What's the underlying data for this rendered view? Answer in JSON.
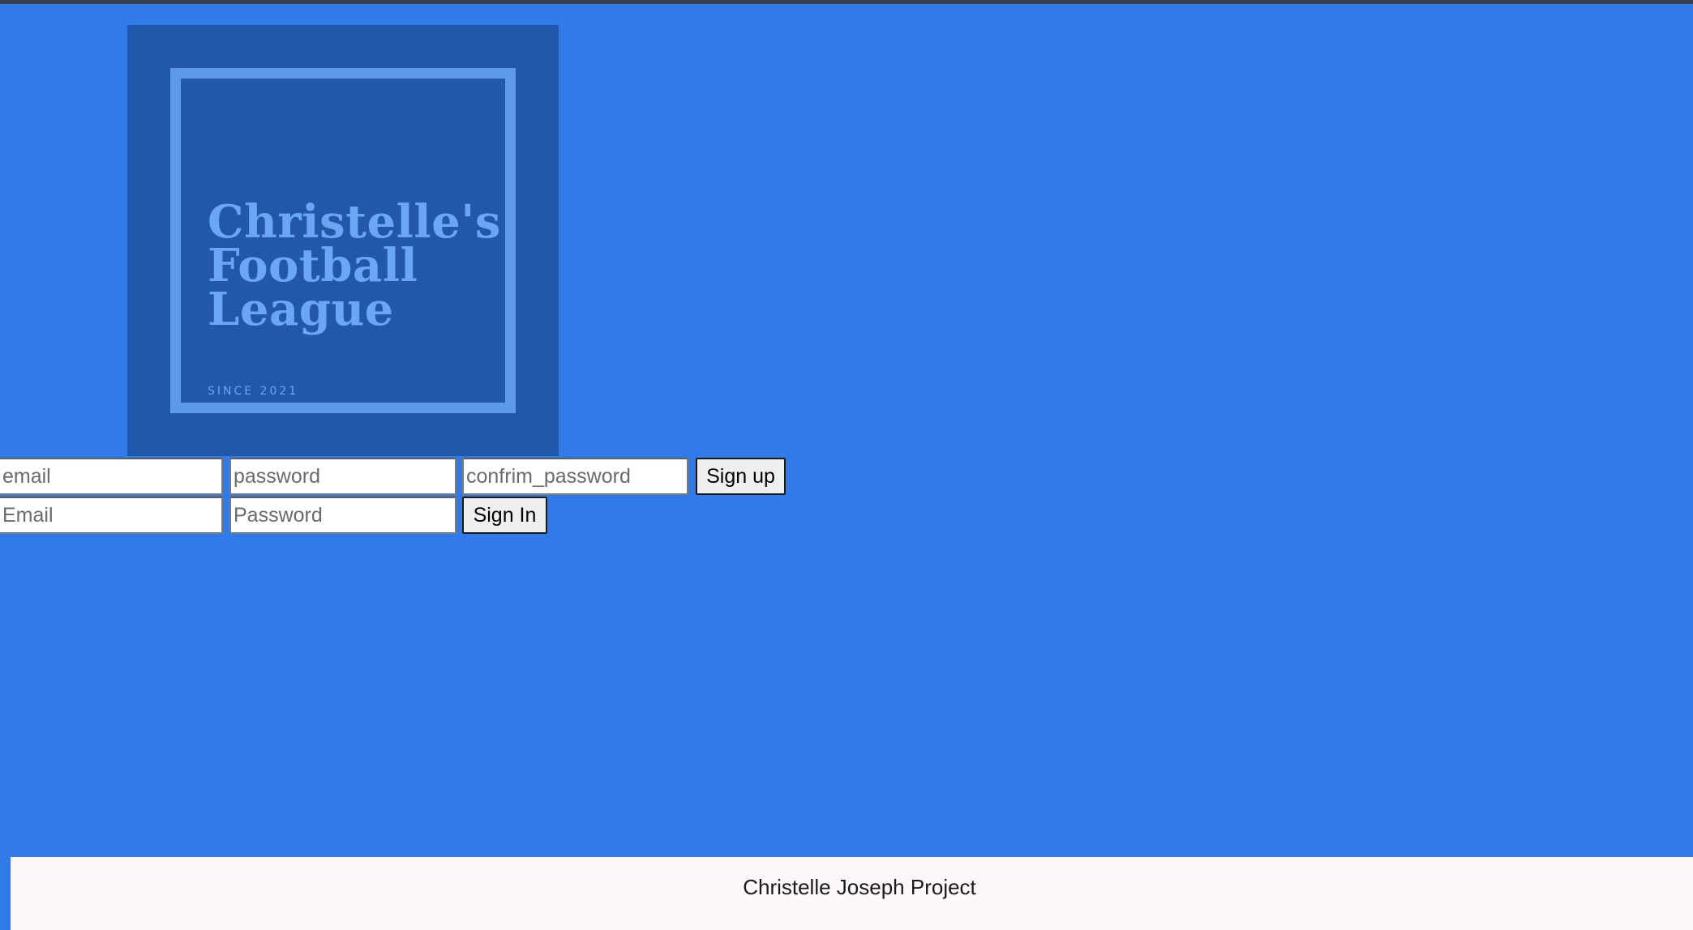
{
  "logo": {
    "title": "Christelle's\nFootball\nLeague",
    "since": "SINCE 2021"
  },
  "signup": {
    "email_placeholder": "email",
    "password_placeholder": "password",
    "confirm_placeholder": "confrim_password",
    "button_label": "Sign up"
  },
  "signin": {
    "email_placeholder": "Email",
    "password_placeholder": "Password",
    "button_label": "Sign In"
  },
  "footer": {
    "text": "Christelle Joseph Project"
  },
  "colors": {
    "page_background": "#307be9",
    "logo_background": "#2358a8",
    "logo_accent": "#6aa6f2",
    "footer_background": "#fcf9f8"
  }
}
